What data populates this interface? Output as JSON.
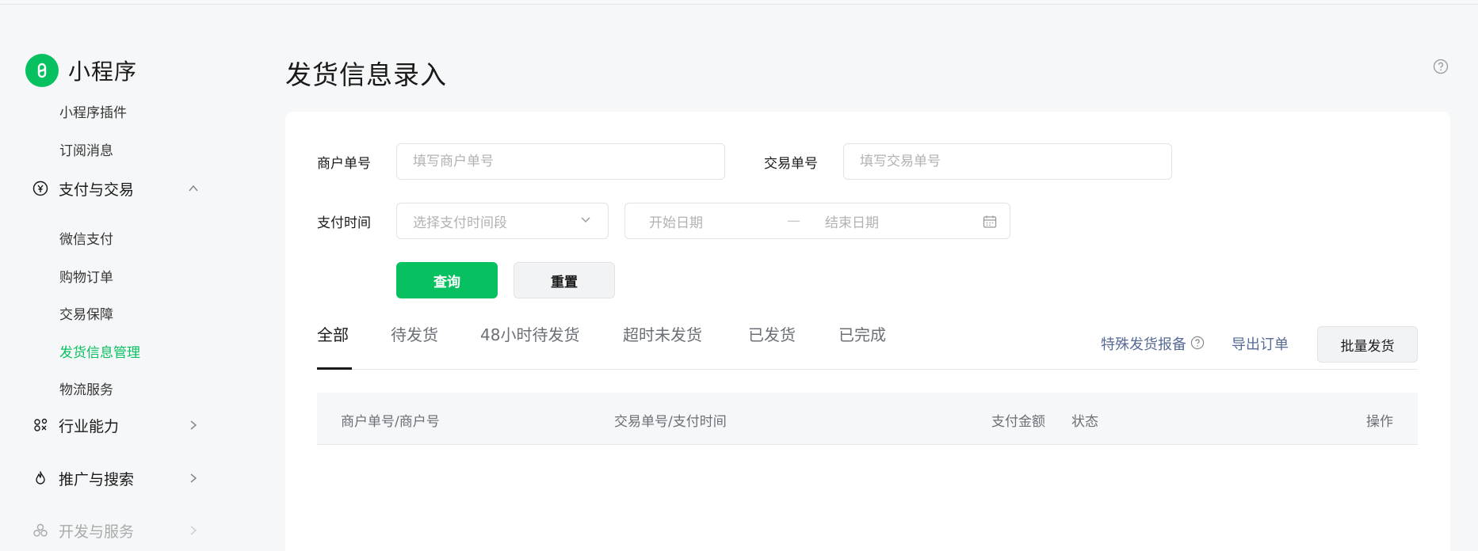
{
  "app": {
    "name": "小程序"
  },
  "sidebar": {
    "items_top": [
      "小程序插件",
      "订阅消息"
    ],
    "pay_group": {
      "label": "支付与交易",
      "icon": "yen-circle-icon"
    },
    "pay_items": [
      "微信支付",
      "购物订单",
      "交易保障",
      "发货信息管理",
      "物流服务"
    ],
    "active_item": "发货信息管理",
    "groups": [
      {
        "label": "行业能力",
        "icon": "industry-icon"
      },
      {
        "label": "推广与搜索",
        "icon": "flame-icon"
      },
      {
        "label": "开发与服务",
        "icon": "cluster-icon"
      }
    ]
  },
  "page": {
    "title": "发货信息录入"
  },
  "filters": {
    "merchant_no_label": "商户单号",
    "merchant_no_placeholder": "填写商户单号",
    "trade_no_label": "交易单号",
    "trade_no_placeholder": "填写交易单号",
    "pay_time_label": "支付时间",
    "pay_time_select": "选择支付时间段",
    "start_date": "开始日期",
    "date_sep": "—",
    "end_date": "结束日期",
    "query_btn": "查询",
    "reset_btn": "重置"
  },
  "tabs": [
    "全部",
    "待发货",
    "48小时待发货",
    "超时未发货",
    "已发货",
    "已完成"
  ],
  "active_tab": "全部",
  "actions": {
    "special_report": "特殊发货报备",
    "export": "导出订单",
    "batch_ship": "批量发货"
  },
  "table": {
    "columns": [
      "商户单号/商户号",
      "交易单号/支付时间",
      "支付金额",
      "状态",
      "操作"
    ]
  },
  "colors": {
    "brand": "#07c160",
    "link": "#576b95"
  }
}
